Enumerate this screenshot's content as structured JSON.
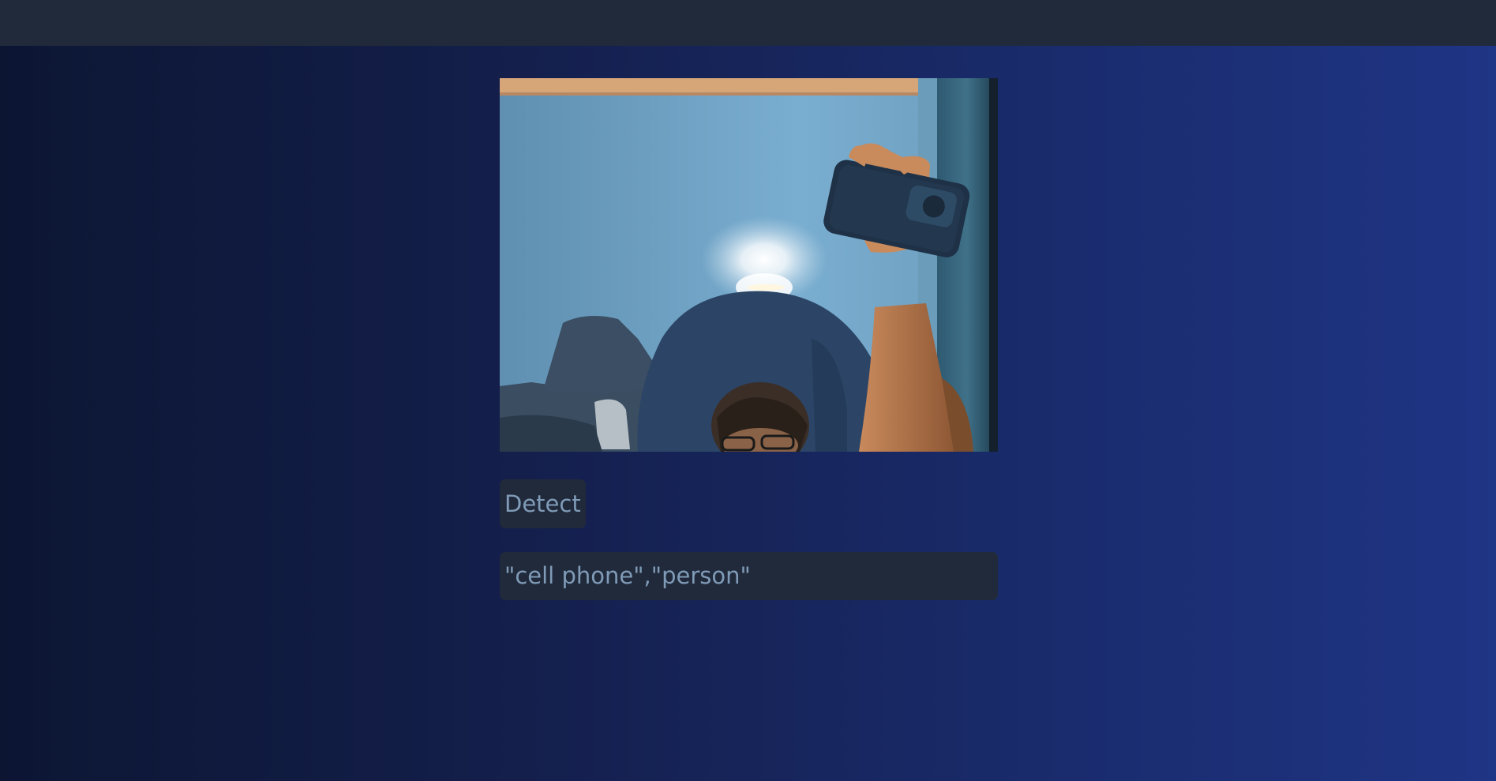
{
  "detect_button": {
    "label": "Detect"
  },
  "results": {
    "text": "\"cell phone\",\"person\""
  },
  "colors": {
    "topbar": "#212a3b",
    "panel": "#212a3b",
    "panel_text": "#7f9bb7",
    "background_start": "#0c1633",
    "background_end": "#1f3585"
  },
  "video": {
    "content": "webcam-frame"
  }
}
